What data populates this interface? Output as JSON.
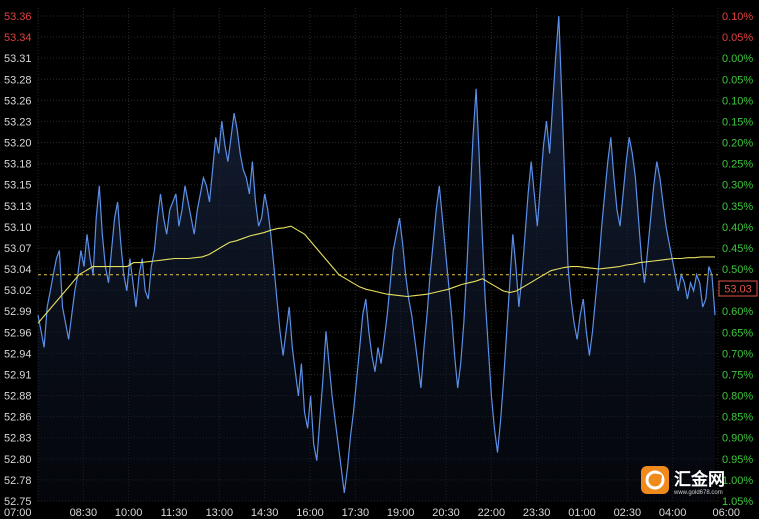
{
  "chart_data": {
    "type": "line",
    "x_tick_labels": [
      "07:00",
      "08:30",
      "10:00",
      "11:30",
      "13:00",
      "14:30",
      "16:00",
      "17:30",
      "19:00",
      "20:30",
      "22:00",
      "23:30",
      "01:00",
      "02:30",
      "04:00",
      "06:00"
    ],
    "y_left_ticks": [
      "53.36",
      "53.34",
      "53.31",
      "53.28",
      "53.26",
      "53.23",
      "53.20",
      "53.18",
      "53.15",
      "53.13",
      "53.10",
      "53.07",
      "53.04",
      "53.02",
      "52.99",
      "52.96",
      "52.94",
      "52.91",
      "52.88",
      "52.86",
      "52.83",
      "52.80",
      "52.78",
      "52.75"
    ],
    "y_right_ticks": [
      "0.10%",
      "0.05%",
      "0.00%",
      "0.05%",
      "0.10%",
      "0.15%",
      "0.20%",
      "0.25%",
      "0.30%",
      "0.35%",
      "0.40%",
      "0.45%",
      "0.50%",
      "0.55%",
      "0.60%",
      "0.65%",
      "0.70%",
      "0.75%",
      "0.80%",
      "0.85%",
      "0.90%",
      "0.95%",
      "1.00%",
      "1.05%"
    ],
    "ylim": [
      52.75,
      53.36
    ],
    "reference_value": 53.03,
    "current_price_label": "53.03",
    "series": [
      {
        "color": "#5b8fe8",
        "values": [
          52.98,
          52.96,
          52.94,
          52.99,
          53.01,
          53.03,
          53.05,
          53.06,
          52.99,
          52.97,
          52.95,
          52.98,
          53.01,
          53.03,
          53.06,
          53.04,
          53.08,
          53.05,
          53.03,
          53.1,
          53.14,
          53.08,
          53.04,
          53.02,
          53.06,
          53.1,
          53.12,
          53.07,
          53.03,
          53.01,
          53.05,
          53.02,
          52.99,
          53.03,
          53.05,
          53.01,
          53.0,
          53.04,
          53.06,
          53.1,
          53.13,
          53.1,
          53.08,
          53.11,
          53.12,
          53.13,
          53.09,
          53.11,
          53.14,
          53.12,
          53.1,
          53.08,
          53.11,
          53.13,
          53.15,
          53.14,
          53.12,
          53.16,
          53.2,
          53.18,
          53.22,
          53.19,
          53.17,
          53.2,
          53.23,
          53.21,
          53.18,
          53.16,
          53.15,
          53.13,
          53.17,
          53.12,
          53.09,
          53.1,
          53.13,
          53.11,
          53.08,
          53.04,
          53.0,
          52.96,
          52.93,
          52.96,
          52.99,
          52.94,
          52.91,
          52.88,
          52.92,
          52.86,
          52.84,
          52.88,
          52.82,
          52.8,
          52.85,
          52.9,
          52.96,
          52.92,
          52.88,
          52.85,
          52.82,
          52.79,
          52.76,
          52.79,
          52.83,
          52.86,
          52.9,
          52.94,
          52.98,
          53.0,
          52.96,
          52.93,
          52.91,
          52.94,
          52.92,
          52.95,
          52.98,
          53.02,
          53.06,
          53.08,
          53.1,
          53.07,
          53.03,
          53.0,
          52.98,
          52.95,
          52.92,
          52.89,
          52.94,
          52.98,
          53.03,
          53.07,
          53.11,
          53.14,
          53.1,
          53.06,
          53.02,
          52.98,
          52.93,
          52.89,
          52.92,
          52.97,
          53.04,
          53.12,
          53.2,
          53.26,
          53.18,
          53.08,
          53.0,
          52.94,
          52.88,
          52.84,
          52.81,
          52.85,
          52.9,
          52.96,
          53.02,
          53.08,
          53.04,
          52.99,
          53.03,
          53.08,
          53.13,
          53.17,
          53.13,
          53.09,
          53.14,
          53.19,
          53.22,
          53.18,
          53.24,
          53.3,
          53.35,
          53.25,
          53.14,
          53.04,
          53.0,
          52.97,
          52.95,
          52.98,
          53.0,
          52.96,
          52.93,
          52.96,
          53.0,
          53.04,
          53.09,
          53.13,
          53.17,
          53.2,
          53.15,
          53.11,
          53.09,
          53.13,
          53.17,
          53.2,
          53.18,
          53.15,
          53.1,
          53.05,
          53.02,
          53.06,
          53.1,
          53.14,
          53.17,
          53.15,
          53.12,
          53.09,
          53.07,
          53.05,
          53.03,
          53.01,
          53.03,
          53.02,
          53.0,
          53.02,
          53.01,
          53.03,
          53.02,
          52.99,
          53.0,
          53.04,
          53.03,
          52.98
        ]
      },
      {
        "color": "#e6e060",
        "values": [
          52.97,
          52.98,
          52.99,
          53.0,
          53.01,
          53.02,
          53.03,
          53.035,
          53.04,
          53.04,
          53.04,
          53.04,
          53.04,
          53.04,
          53.045,
          53.045,
          53.046,
          53.047,
          53.048,
          53.049,
          53.05,
          53.05,
          53.05,
          53.051,
          53.052,
          53.055,
          53.06,
          53.065,
          53.07,
          53.072,
          53.075,
          53.078,
          53.08,
          53.082,
          53.085,
          53.087,
          53.088,
          53.09,
          53.085,
          53.08,
          53.07,
          53.06,
          53.05,
          53.04,
          53.03,
          53.025,
          53.02,
          53.015,
          53.012,
          53.01,
          53.008,
          53.006,
          53.005,
          53.004,
          53.003,
          53.004,
          53.005,
          53.006,
          53.008,
          53.01,
          53.012,
          53.015,
          53.018,
          53.02,
          53.022,
          53.025,
          53.02,
          53.015,
          53.01,
          53.008,
          53.01,
          53.015,
          53.02,
          53.025,
          53.03,
          53.035,
          53.037,
          53.039,
          53.04,
          53.04,
          53.039,
          53.038,
          53.037,
          53.038,
          53.039,
          53.04,
          53.042,
          53.043,
          53.045,
          53.046,
          53.047,
          53.048,
          53.049,
          53.05,
          53.05,
          53.051,
          53.051,
          53.052,
          53.052,
          53.052
        ]
      }
    ]
  },
  "logo": {
    "name": "汇金网",
    "url": "www.gold678.com"
  },
  "colors": {
    "background": "#000000",
    "grid": "#2a2a2a",
    "axis_text_left_up": "#e04040",
    "axis_text_left_down": "#d8d8d8",
    "axis_text_right_up": "#e04040",
    "axis_text_right_down": "#3cc83c",
    "price_line": "#5b8fe8",
    "average_line": "#e6e060",
    "reference_line": "#e6c840",
    "logo_orange": "#f08a1c"
  }
}
